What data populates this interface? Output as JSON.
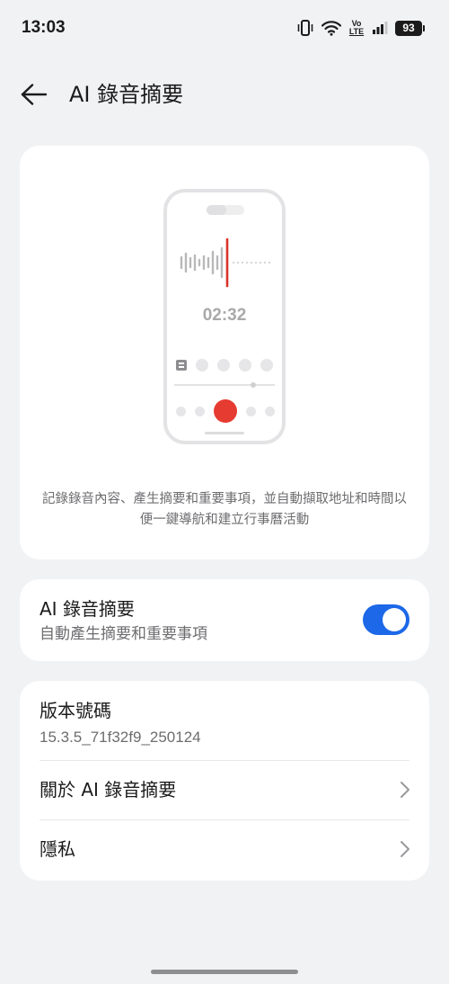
{
  "status_bar": {
    "time": "13:03",
    "volte_top": "Vo",
    "volte_bottom": "LTE",
    "battery": "93",
    "icons": [
      "vibrate-icon",
      "wifi-icon",
      "volte-icon",
      "signal-icon",
      "battery-icon"
    ]
  },
  "header": {
    "back_icon": "arrow-left-icon",
    "title": "AI 錄音摘要"
  },
  "illustration": {
    "timer": "02:32",
    "caption": "記錄錄音內容、產生摘要和重要事項，並自動擷取地址和時間以便一鍵導航和建立行事曆活動",
    "record_color": "#e63b31"
  },
  "toggle": {
    "title": "AI 錄音摘要",
    "subtitle": "自動產生摘要和重要事項",
    "enabled": true,
    "accent": "#1c68e8"
  },
  "info": {
    "version_label": "版本號碼",
    "version_value": "15.3.5_71f32f9_250124",
    "about_label": "關於 AI 錄音摘要",
    "privacy_label": "隱私",
    "chevron_icon": "chevron-right-icon"
  }
}
